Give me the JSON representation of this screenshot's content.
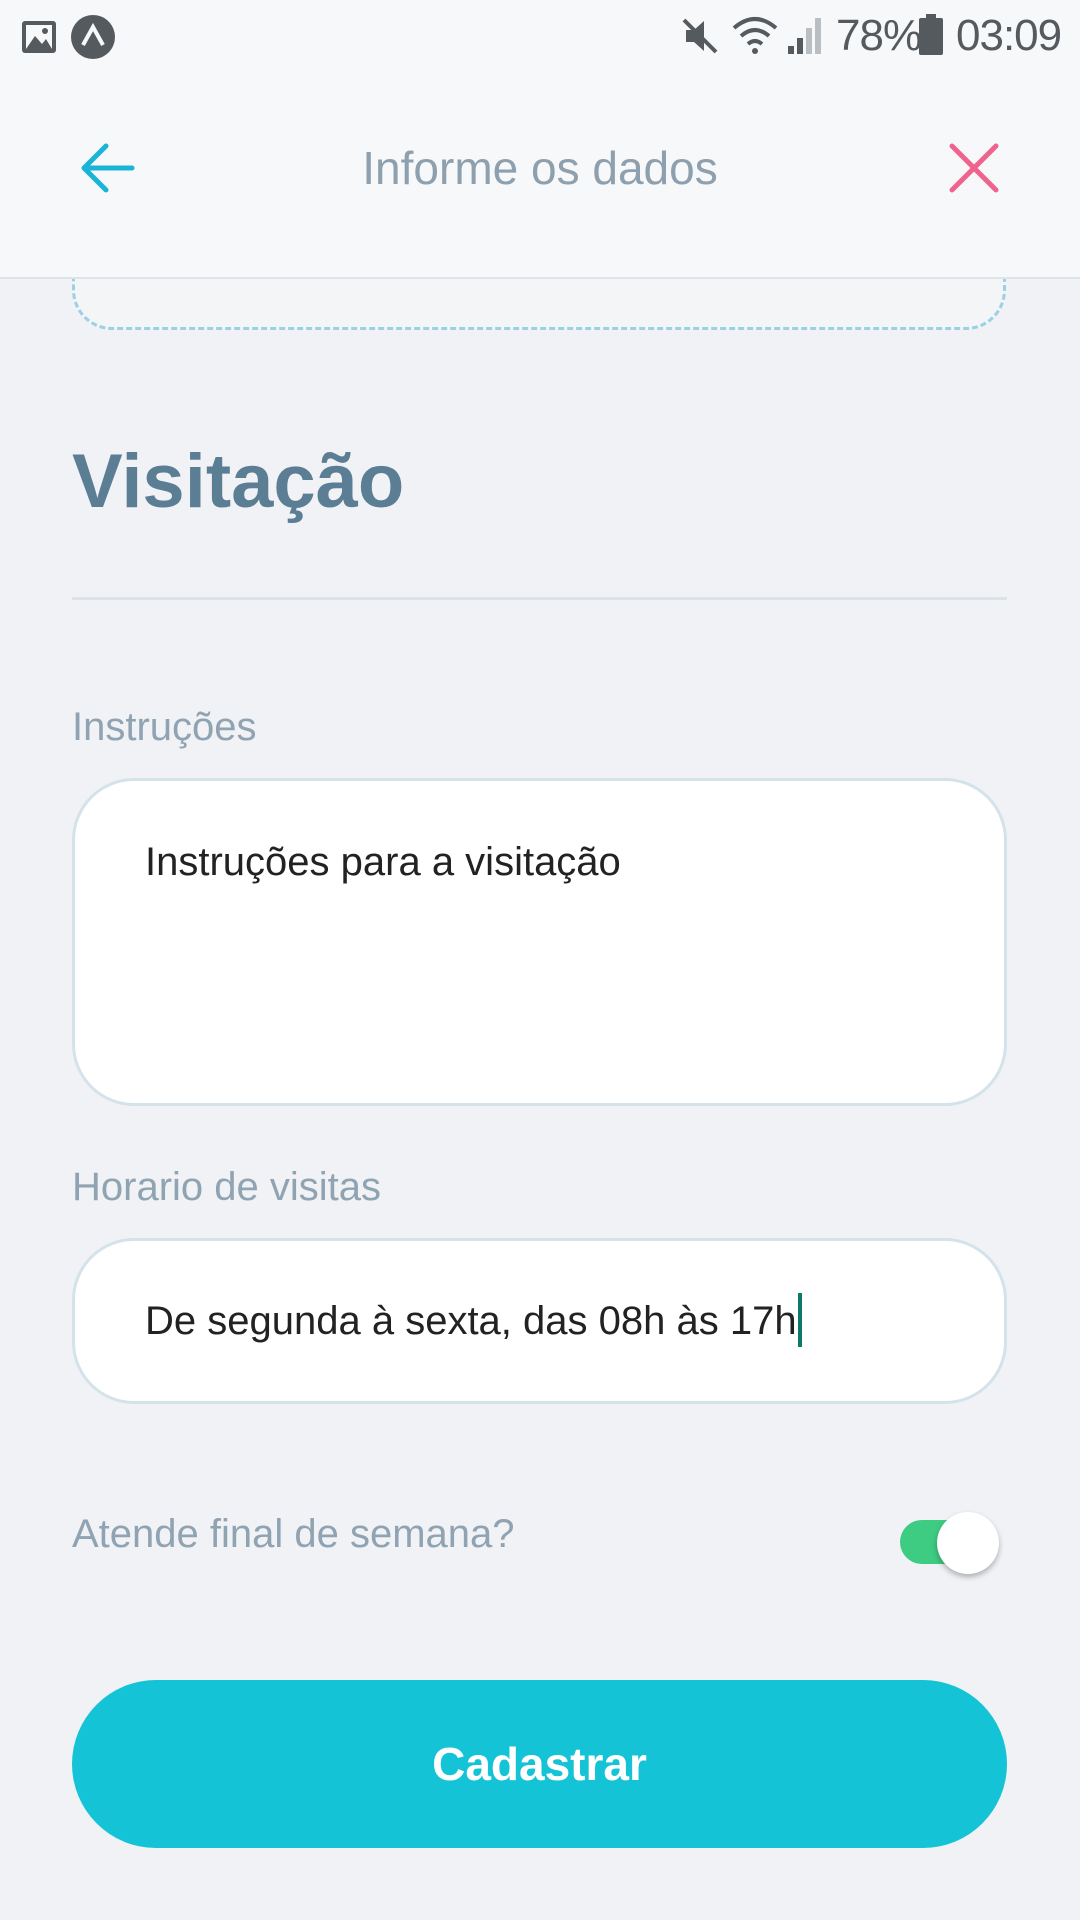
{
  "status_bar": {
    "icons": [
      "image-icon",
      "app-badge-icon",
      "mute-icon",
      "wifi-icon",
      "signal-icon",
      "battery-icon"
    ],
    "battery": "78%",
    "time": "03:09"
  },
  "header": {
    "title": "Informe os dados",
    "back_icon": "arrow-left-icon",
    "close_icon": "close-icon",
    "back_color": "#1ab4d6",
    "close_color": "#f0638f"
  },
  "section": {
    "title": "Visitação"
  },
  "instructions": {
    "label": "Instruções",
    "value": "Instruções para a visitação"
  },
  "visit_hours": {
    "label": "Horario de visitas",
    "value": "De segunda à sexta, das 08h às 17h"
  },
  "weekend": {
    "label": "Atende final de semana?",
    "enabled": true,
    "toggle_color": "#3ecb82"
  },
  "submit": {
    "label": "Cadastrar",
    "color": "#14c3d6"
  }
}
